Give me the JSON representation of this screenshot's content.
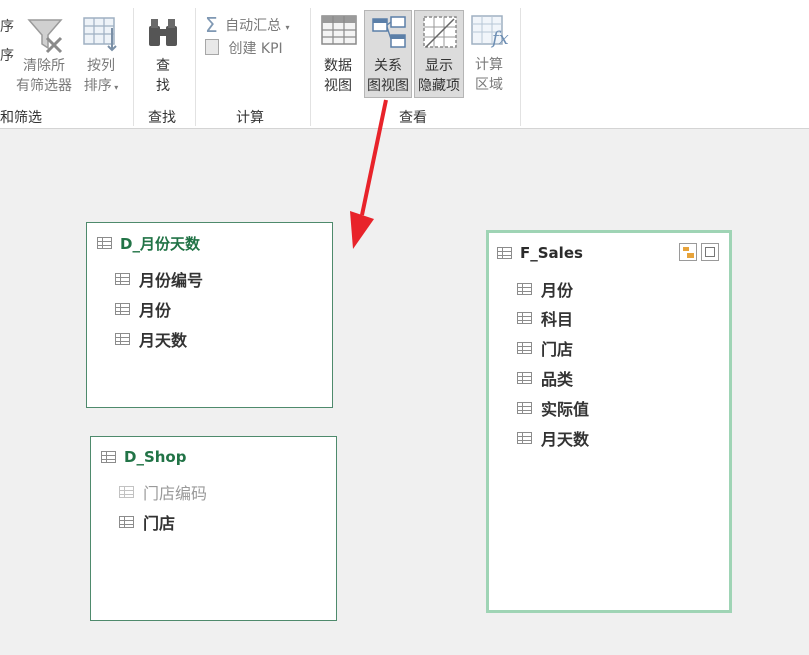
{
  "ribbon": {
    "partial_top": "序",
    "partial_mid": "序",
    "clear_filters": [
      "清除所",
      "有筛选器"
    ],
    "sort_by_column": [
      "按列",
      "排序"
    ],
    "find": [
      "查",
      "找"
    ],
    "auto_sum": "自动汇总",
    "create_kpi": "创建 KPI",
    "data_view": [
      "数据",
      "视图"
    ],
    "diagram_view": [
      "关系",
      "图视图"
    ],
    "show_hidden": [
      "显示",
      "隐藏项"
    ],
    "calc_area": [
      "计算",
      "区域"
    ],
    "groups": {
      "sort_filter": "和筛选",
      "find": "查找",
      "calc": "计算",
      "view": "查看"
    }
  },
  "colors": {
    "table_title_green": "#217346",
    "selected_border": "#9fd4b5",
    "arrow": "#e8232a"
  },
  "tables": {
    "month_days": {
      "title": "D_月份天数",
      "columns": [
        "月份编号",
        "月份",
        "月天数"
      ]
    },
    "shop": {
      "title": "D_Shop",
      "hidden_column": "门店编码",
      "columns": [
        "门店"
      ]
    },
    "sales": {
      "title": "F_Sales",
      "columns": [
        "月份",
        "科目",
        "门店",
        "品类",
        "实际值",
        "月天数"
      ]
    }
  }
}
